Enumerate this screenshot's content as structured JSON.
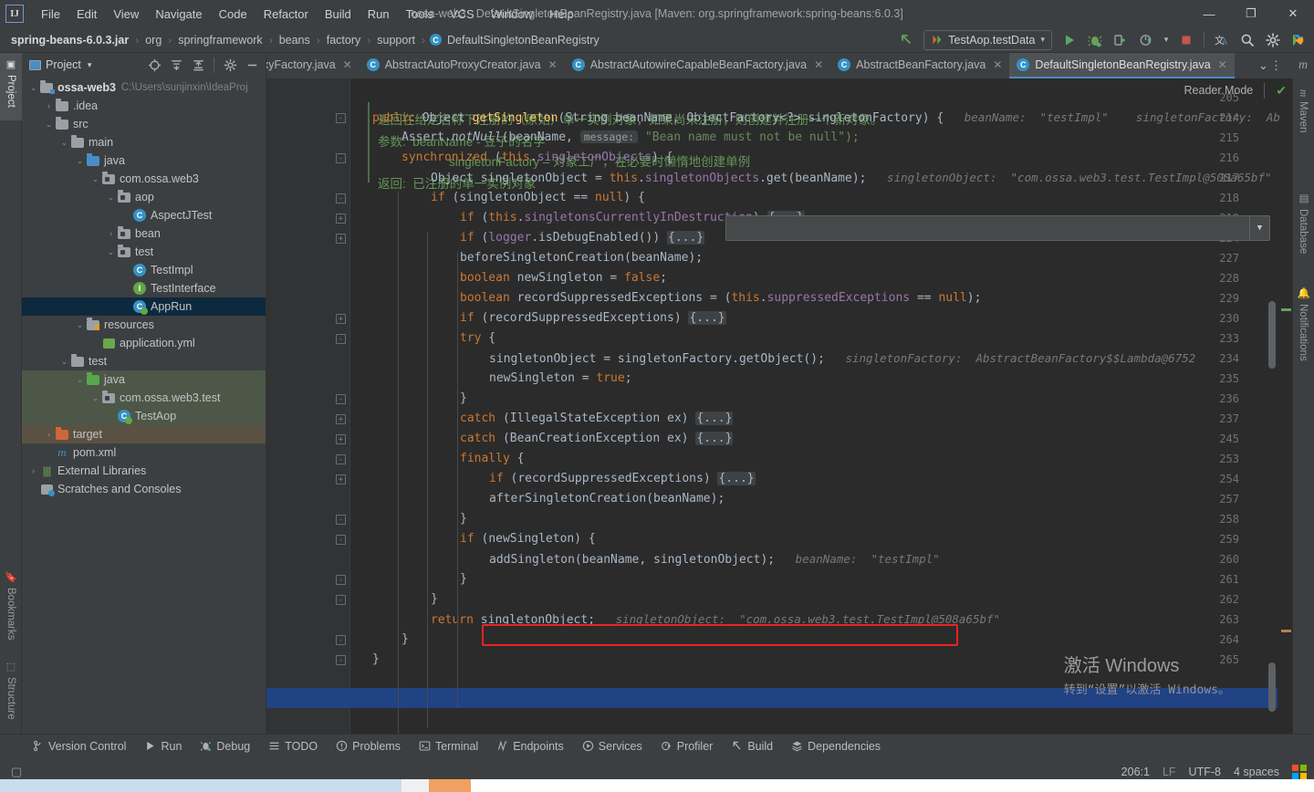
{
  "window": {
    "title": "ossa-web3 - DefaultSingletonBeanRegistry.java [Maven: org.springframework:spring-beans:6.0.3]",
    "logo": "IJ",
    "minimize": "—",
    "maximize": "❐",
    "close": "✕"
  },
  "menubar": [
    "File",
    "Edit",
    "View",
    "Navigate",
    "Code",
    "Refactor",
    "Build",
    "Run",
    "Tools",
    "VCS",
    "Window",
    "Help"
  ],
  "breadcrumb": {
    "items": [
      "spring-beans-6.0.3.jar",
      "org",
      "springframework",
      "beans",
      "factory",
      "support"
    ],
    "separator": "›",
    "class_icon_letter": "C",
    "class_name": "DefaultSingletonBeanRegistry"
  },
  "toolbar": {
    "back_arrow": "back-arrow-icon",
    "run_config": "TestAop.testData",
    "dropdown_caret": "▾",
    "run": "run-icon",
    "debug": "debug-icon",
    "run_coverage": "run-with-coverage-icon",
    "profiler": "profiler-icon",
    "stop": "stop-icon",
    "translate": "translate-icon",
    "search": "search-icon",
    "settings": "settings-icon",
    "ide_extra": "ide-extra-icon"
  },
  "left_tool_strip": [
    {
      "label": "Project",
      "icon": "project-icon",
      "active": true
    },
    {
      "label": "Bookmarks",
      "icon": "bookmarks-icon",
      "active": false
    },
    {
      "label": "Structure",
      "icon": "structure-icon",
      "active": false
    }
  ],
  "right_tool_strip": [
    {
      "label": "Maven",
      "icon": "maven-icon"
    },
    {
      "label": "Database",
      "icon": "database-icon"
    },
    {
      "label": "Notifications",
      "icon": "notifications-icon"
    }
  ],
  "project_panel": {
    "title": "Project",
    "dropdown_caret": "▾",
    "actions": [
      {
        "name": "select-opened-file-button",
        "glyph": "⊕"
      },
      {
        "name": "expand-all-button",
        "glyph": "⤓"
      },
      {
        "name": "collapse-all-button",
        "glyph": "⤒"
      },
      {
        "name": "settings-button",
        "glyph": "⚙"
      },
      {
        "name": "hide-button",
        "glyph": "—"
      }
    ],
    "tree": [
      {
        "depth": 0,
        "arrow": "⌄",
        "icon": "module-folder",
        "label": "ossa-web3",
        "bold": true,
        "path": "C:\\Users\\sunjinxin\\IdeaProj",
        "state": "none"
      },
      {
        "depth": 1,
        "arrow": "›",
        "icon": "folder-gray",
        "label": ".idea",
        "state": "none"
      },
      {
        "depth": 1,
        "arrow": "⌄",
        "icon": "folder-gray",
        "label": "src",
        "state": "none"
      },
      {
        "depth": 2,
        "arrow": "⌄",
        "icon": "folder-gray",
        "label": "main",
        "state": "none"
      },
      {
        "depth": 3,
        "arrow": "⌄",
        "icon": "folder-blue",
        "label": "java",
        "state": "none"
      },
      {
        "depth": 4,
        "arrow": "⌄",
        "icon": "package",
        "label": "com.ossa.web3",
        "state": "none"
      },
      {
        "depth": 5,
        "arrow": "⌄",
        "icon": "package",
        "label": "aop",
        "state": "none"
      },
      {
        "depth": 6,
        "arrow": "",
        "icon": "class-blue",
        "label": "AspectJTest",
        "state": "none"
      },
      {
        "depth": 5,
        "arrow": "›",
        "icon": "package",
        "label": "bean",
        "state": "none"
      },
      {
        "depth": 5,
        "arrow": "⌄",
        "icon": "package",
        "label": "test",
        "state": "none"
      },
      {
        "depth": 6,
        "arrow": "",
        "icon": "class-blue",
        "label": "TestImpl",
        "state": "none"
      },
      {
        "depth": 6,
        "arrow": "",
        "icon": "interface-green",
        "label": "TestInterface",
        "state": "none"
      },
      {
        "depth": 6,
        "arrow": "",
        "icon": "class-runnable",
        "label": "AppRun",
        "state": "selected"
      },
      {
        "depth": 3,
        "arrow": "⌄",
        "icon": "folder-resources",
        "label": "resources",
        "state": "none"
      },
      {
        "depth": 4,
        "arrow": "",
        "icon": "yml-file",
        "label": "application.yml",
        "state": "none"
      },
      {
        "depth": 2,
        "arrow": "⌄",
        "icon": "folder-gray",
        "label": "test",
        "state": "none"
      },
      {
        "depth": 3,
        "arrow": "⌄",
        "icon": "folder-green",
        "label": "java",
        "state": "green"
      },
      {
        "depth": 4,
        "arrow": "⌄",
        "icon": "package",
        "label": "com.ossa.web3.test",
        "state": "green"
      },
      {
        "depth": 5,
        "arrow": "",
        "icon": "class-test",
        "label": "TestAop",
        "state": "green"
      },
      {
        "depth": 1,
        "arrow": "›",
        "icon": "folder-orange",
        "label": "target",
        "state": "brown"
      },
      {
        "depth": 1,
        "arrow": "",
        "icon": "maven-file",
        "label": "pom.xml",
        "state": "none"
      },
      {
        "depth": 0,
        "arrow": "›",
        "icon": "libraries",
        "label": "External Libraries",
        "state": "none"
      },
      {
        "depth": 0,
        "arrow": "",
        "icon": "scratches",
        "label": "Scratches and Consoles",
        "state": "none"
      }
    ]
  },
  "editor_tabs": {
    "tabs": [
      {
        "label": "xyFactory.java",
        "active": false,
        "truncated": true
      },
      {
        "label": "AbstractAutoProxyCreator.java",
        "active": false
      },
      {
        "label": "AbstractAutowireCapableBeanFactory.java",
        "active": false
      },
      {
        "label": "AbstractBeanFactory.java",
        "active": false
      },
      {
        "label": "DefaultSingletonBeanRegistry.java",
        "active": true
      }
    ],
    "close_glyph": "✕",
    "class_icon_letter": "C",
    "overflow_caret": "⌄",
    "more_glyph": "⋮"
  },
  "editor": {
    "reader_mode_label": "Reader Mode",
    "inspection_ok": "✔",
    "javadoc": [
      "返回在给定名称下注册的（原始）单一实例对象，如果尚未注册，则创建并注册一个新对象。",
      "参数:  beanName - 豆子的名字",
      "        singletonFactory – 对象工厂，在必要时懒惰地创建单例",
      "返回:  已注册的单一实例对象"
    ],
    "line_numbers": [
      "205",
      "214",
      "215",
      "216",
      "217",
      "218",
      "219",
      "224",
      "227",
      "228",
      "229",
      "230",
      "233",
      "234",
      "235",
      "236",
      "237",
      "245",
      "253",
      "254",
      "257",
      "258",
      "259",
      "260",
      "261",
      "262",
      "263",
      "264",
      "265"
    ],
    "inline_hints": {
      "l214_beanname": "beanName:  \"testImpl\"",
      "l214_factory": "singletonFactory:  Ab",
      "l215_message": "message:",
      "l215_str": "\"Bean name must not be null\");",
      "l217": "singletonObject:  \"com.ossa.web3.test.TestImpl@508a65bf\"",
      "l234": "singletonFactory:  AbstractBeanFactory$$Lambda@6752",
      "l260": "beanName:  \"testImpl\"",
      "l263": "singletonObject:  \"com.ossa.web3.test.TestImpl@508a65bf\""
    },
    "fold_placeholder": "{...}",
    "highlighted_line": "263",
    "red_box_line": "260"
  },
  "watermark": {
    "line1": "激活 Windows",
    "line2": "转到“设置”以激活 Windows。"
  },
  "bottom_bar": [
    {
      "label": "Version Control",
      "icon": "branch-icon"
    },
    {
      "label": "Run",
      "icon": "run-icon"
    },
    {
      "label": "Debug",
      "icon": "debug-icon"
    },
    {
      "label": "TODO",
      "icon": "todo-icon"
    },
    {
      "label": "Problems",
      "icon": "problems-icon"
    },
    {
      "label": "Terminal",
      "icon": "terminal-icon"
    },
    {
      "label": "Endpoints",
      "icon": "endpoints-icon"
    },
    {
      "label": "Services",
      "icon": "services-icon"
    },
    {
      "label": "Profiler",
      "icon": "profiler-icon"
    },
    {
      "label": "Build",
      "icon": "build-icon"
    },
    {
      "label": "Dependencies",
      "icon": "dependencies-icon"
    }
  ],
  "status_bar": {
    "caret_position": "206:1",
    "line_separator": "LF",
    "encoding": "UTF-8",
    "indent": "4 spaces",
    "os_logo": "windows-logo-icon"
  },
  "colors": {
    "accent_blue": "#4a88c7",
    "selection_blue": "#214283",
    "keyword_orange": "#cc7832",
    "method_yellow": "#ffc66d",
    "field_purple": "#9876aa",
    "string_green": "#6a8759",
    "comment_green": "#629755",
    "error_red": "#ee2222",
    "bg_editor": "#2b2b2b",
    "bg_panel": "#3c3f41"
  }
}
